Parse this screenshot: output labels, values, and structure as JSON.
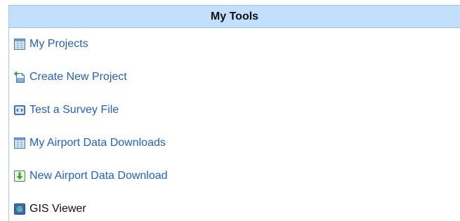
{
  "panel": {
    "title": "My Tools"
  },
  "tools": [
    {
      "label": "My Projects",
      "icon": "grid-table-icon"
    },
    {
      "label": "Create New Project",
      "icon": "new-document-icon"
    },
    {
      "label": "Test a Survey File",
      "icon": "code-file-icon"
    },
    {
      "label": "My Airport Data Downloads",
      "icon": "grid-table-icon"
    },
    {
      "label": "New Airport Data Download",
      "icon": "download-arrow-icon"
    },
    {
      "label": "GIS Viewer",
      "icon": "globe-icon"
    }
  ],
  "colors": {
    "header_bg": "#c2e0fb",
    "link": "#1f5fd6",
    "plain_text": "#111111"
  }
}
